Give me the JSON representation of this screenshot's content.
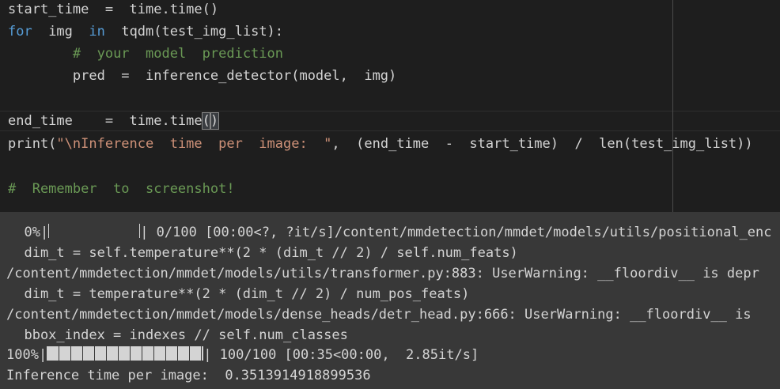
{
  "editor": {
    "lines": [
      {
        "code": "start_time  =  time.time()"
      },
      {
        "kw1": "for",
        "mid1": "  img  ",
        "kw2": "in",
        "rest": "  tqdm(test_img_list):"
      },
      {
        "indent": "        ",
        "comment": "#  your  model  prediction"
      },
      {
        "code": "        pred  =  inference_detector(model,  img)"
      },
      {
        "code": ""
      },
      {
        "pre": "end_time    =  time.time",
        "open": "(",
        "close": ")"
      },
      {
        "pre": "print(",
        "str": "\"\\nInference  time  per  image:  \"",
        "post": ",  (end_time  -  start_time)  /  len(test_img_list))"
      },
      {
        "code": ""
      },
      {
        "comment": "#  Remember  to  screenshot!"
      }
    ]
  },
  "output": {
    "line1_pct": "  0%|",
    "line1_rest": "| 0/100 [00:00<?, ?it/s]/content/mmdetection/mmdet/models/utils/positional_enc",
    "line2": "  dim_t = self.temperature**(2 * (dim_t // 2) / self.num_feats)",
    "line3": "/content/mmdetection/mmdet/models/utils/transformer.py:883: UserWarning: __floordiv__ is depr",
    "line4": "  dim_t = temperature**(2 * (dim_t // 2) / num_pos_feats)",
    "line5": "/content/mmdetection/mmdet/models/dense_heads/detr_head.py:666: UserWarning: __floordiv__ is",
    "line6": "  bbox_index = indexes // self.num_classes",
    "line7_pct": "100%|",
    "line7_rest": "| 100/100 [00:35<00:00,  2.85it/s]",
    "line8": "Inference time per image:  0.3513914918899536",
    "progress_start": 0.0,
    "progress_end": 1.0
  }
}
